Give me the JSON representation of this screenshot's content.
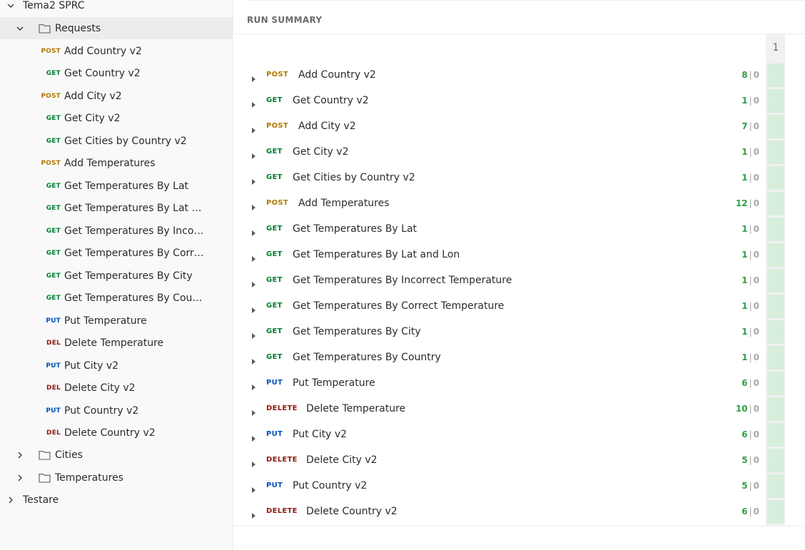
{
  "sidebar": {
    "collection": "Tema2 SPRC",
    "folders": {
      "requests": "Requests",
      "cities": "Cities",
      "temperatures": "Temperatures"
    },
    "requests": [
      {
        "method": "POST",
        "name": "Add Country v2"
      },
      {
        "method": "GET",
        "name": "Get Country v2"
      },
      {
        "method": "POST",
        "name": "Add City v2"
      },
      {
        "method": "GET",
        "name": "Get City v2"
      },
      {
        "method": "GET",
        "name": "Get Cities by Country v2"
      },
      {
        "method": "POST",
        "name": "Add Temperatures"
      },
      {
        "method": "GET",
        "name": "Get Temperatures By Lat"
      },
      {
        "method": "GET",
        "name": "Get Temperatures By Lat an..."
      },
      {
        "method": "GET",
        "name": "Get Temperatures By Incorre..."
      },
      {
        "method": "GET",
        "name": "Get Temperatures By Correc..."
      },
      {
        "method": "GET",
        "name": "Get Temperatures By City"
      },
      {
        "method": "GET",
        "name": "Get Temperatures By Country"
      },
      {
        "method": "PUT",
        "name": "Put Temperature"
      },
      {
        "method": "DEL",
        "name": "Delete Temperature"
      },
      {
        "method": "PUT",
        "name": "Put City v2"
      },
      {
        "method": "DEL",
        "name": "Delete City v2"
      },
      {
        "method": "PUT",
        "name": "Put Country v2"
      },
      {
        "method": "DEL",
        "name": "Delete Country v2"
      }
    ],
    "other_collection": "Testare"
  },
  "main": {
    "title": "RUN SUMMARY",
    "iteration_label": "1",
    "separator": "|",
    "rows": [
      {
        "method": "POST",
        "name": "Add Country v2",
        "passed": "8",
        "failed": "0"
      },
      {
        "method": "GET",
        "name": "Get Country v2",
        "passed": "1",
        "failed": "0"
      },
      {
        "method": "POST",
        "name": "Add City v2",
        "passed": "7",
        "failed": "0"
      },
      {
        "method": "GET",
        "name": "Get City v2",
        "passed": "1",
        "failed": "0"
      },
      {
        "method": "GET",
        "name": "Get Cities by Country v2",
        "passed": "1",
        "failed": "0"
      },
      {
        "method": "POST",
        "name": "Add Temperatures",
        "passed": "12",
        "failed": "0"
      },
      {
        "method": "GET",
        "name": "Get Temperatures By Lat",
        "passed": "1",
        "failed": "0"
      },
      {
        "method": "GET",
        "name": "Get Temperatures By Lat and Lon",
        "passed": "1",
        "failed": "0"
      },
      {
        "method": "GET",
        "name": "Get Temperatures By Incorrect Temperature",
        "passed": "1",
        "failed": "0"
      },
      {
        "method": "GET",
        "name": "Get Temperatures By Correct Temperature",
        "passed": "1",
        "failed": "0"
      },
      {
        "method": "GET",
        "name": "Get Temperatures By City",
        "passed": "1",
        "failed": "0"
      },
      {
        "method": "GET",
        "name": "Get Temperatures By Country",
        "passed": "1",
        "failed": "0"
      },
      {
        "method": "PUT",
        "name": "Put Temperature",
        "passed": "6",
        "failed": "0"
      },
      {
        "method": "DELETE",
        "name": "Delete Temperature",
        "passed": "10",
        "failed": "0"
      },
      {
        "method": "PUT",
        "name": "Put City v2",
        "passed": "6",
        "failed": "0"
      },
      {
        "method": "DELETE",
        "name": "Delete City v2",
        "passed": "5",
        "failed": "0"
      },
      {
        "method": "PUT",
        "name": "Put Country v2",
        "passed": "5",
        "failed": "0"
      },
      {
        "method": "DELETE",
        "name": "Delete Country v2",
        "passed": "6",
        "failed": "0"
      }
    ]
  },
  "colors": {
    "POST": "#ad7a03",
    "GET": "#007f31",
    "PUT": "#0053b8",
    "DEL": "#8e1a10",
    "DELETE": "#8e1a10",
    "pass": "#2f9e44",
    "result_cell": "#d7eedd"
  },
  "icons": {
    "expanded": "chevron-down-icon",
    "collapsed": "chevron-right-icon",
    "folder": "folder-icon",
    "row_expand": "caret-right-icon"
  }
}
